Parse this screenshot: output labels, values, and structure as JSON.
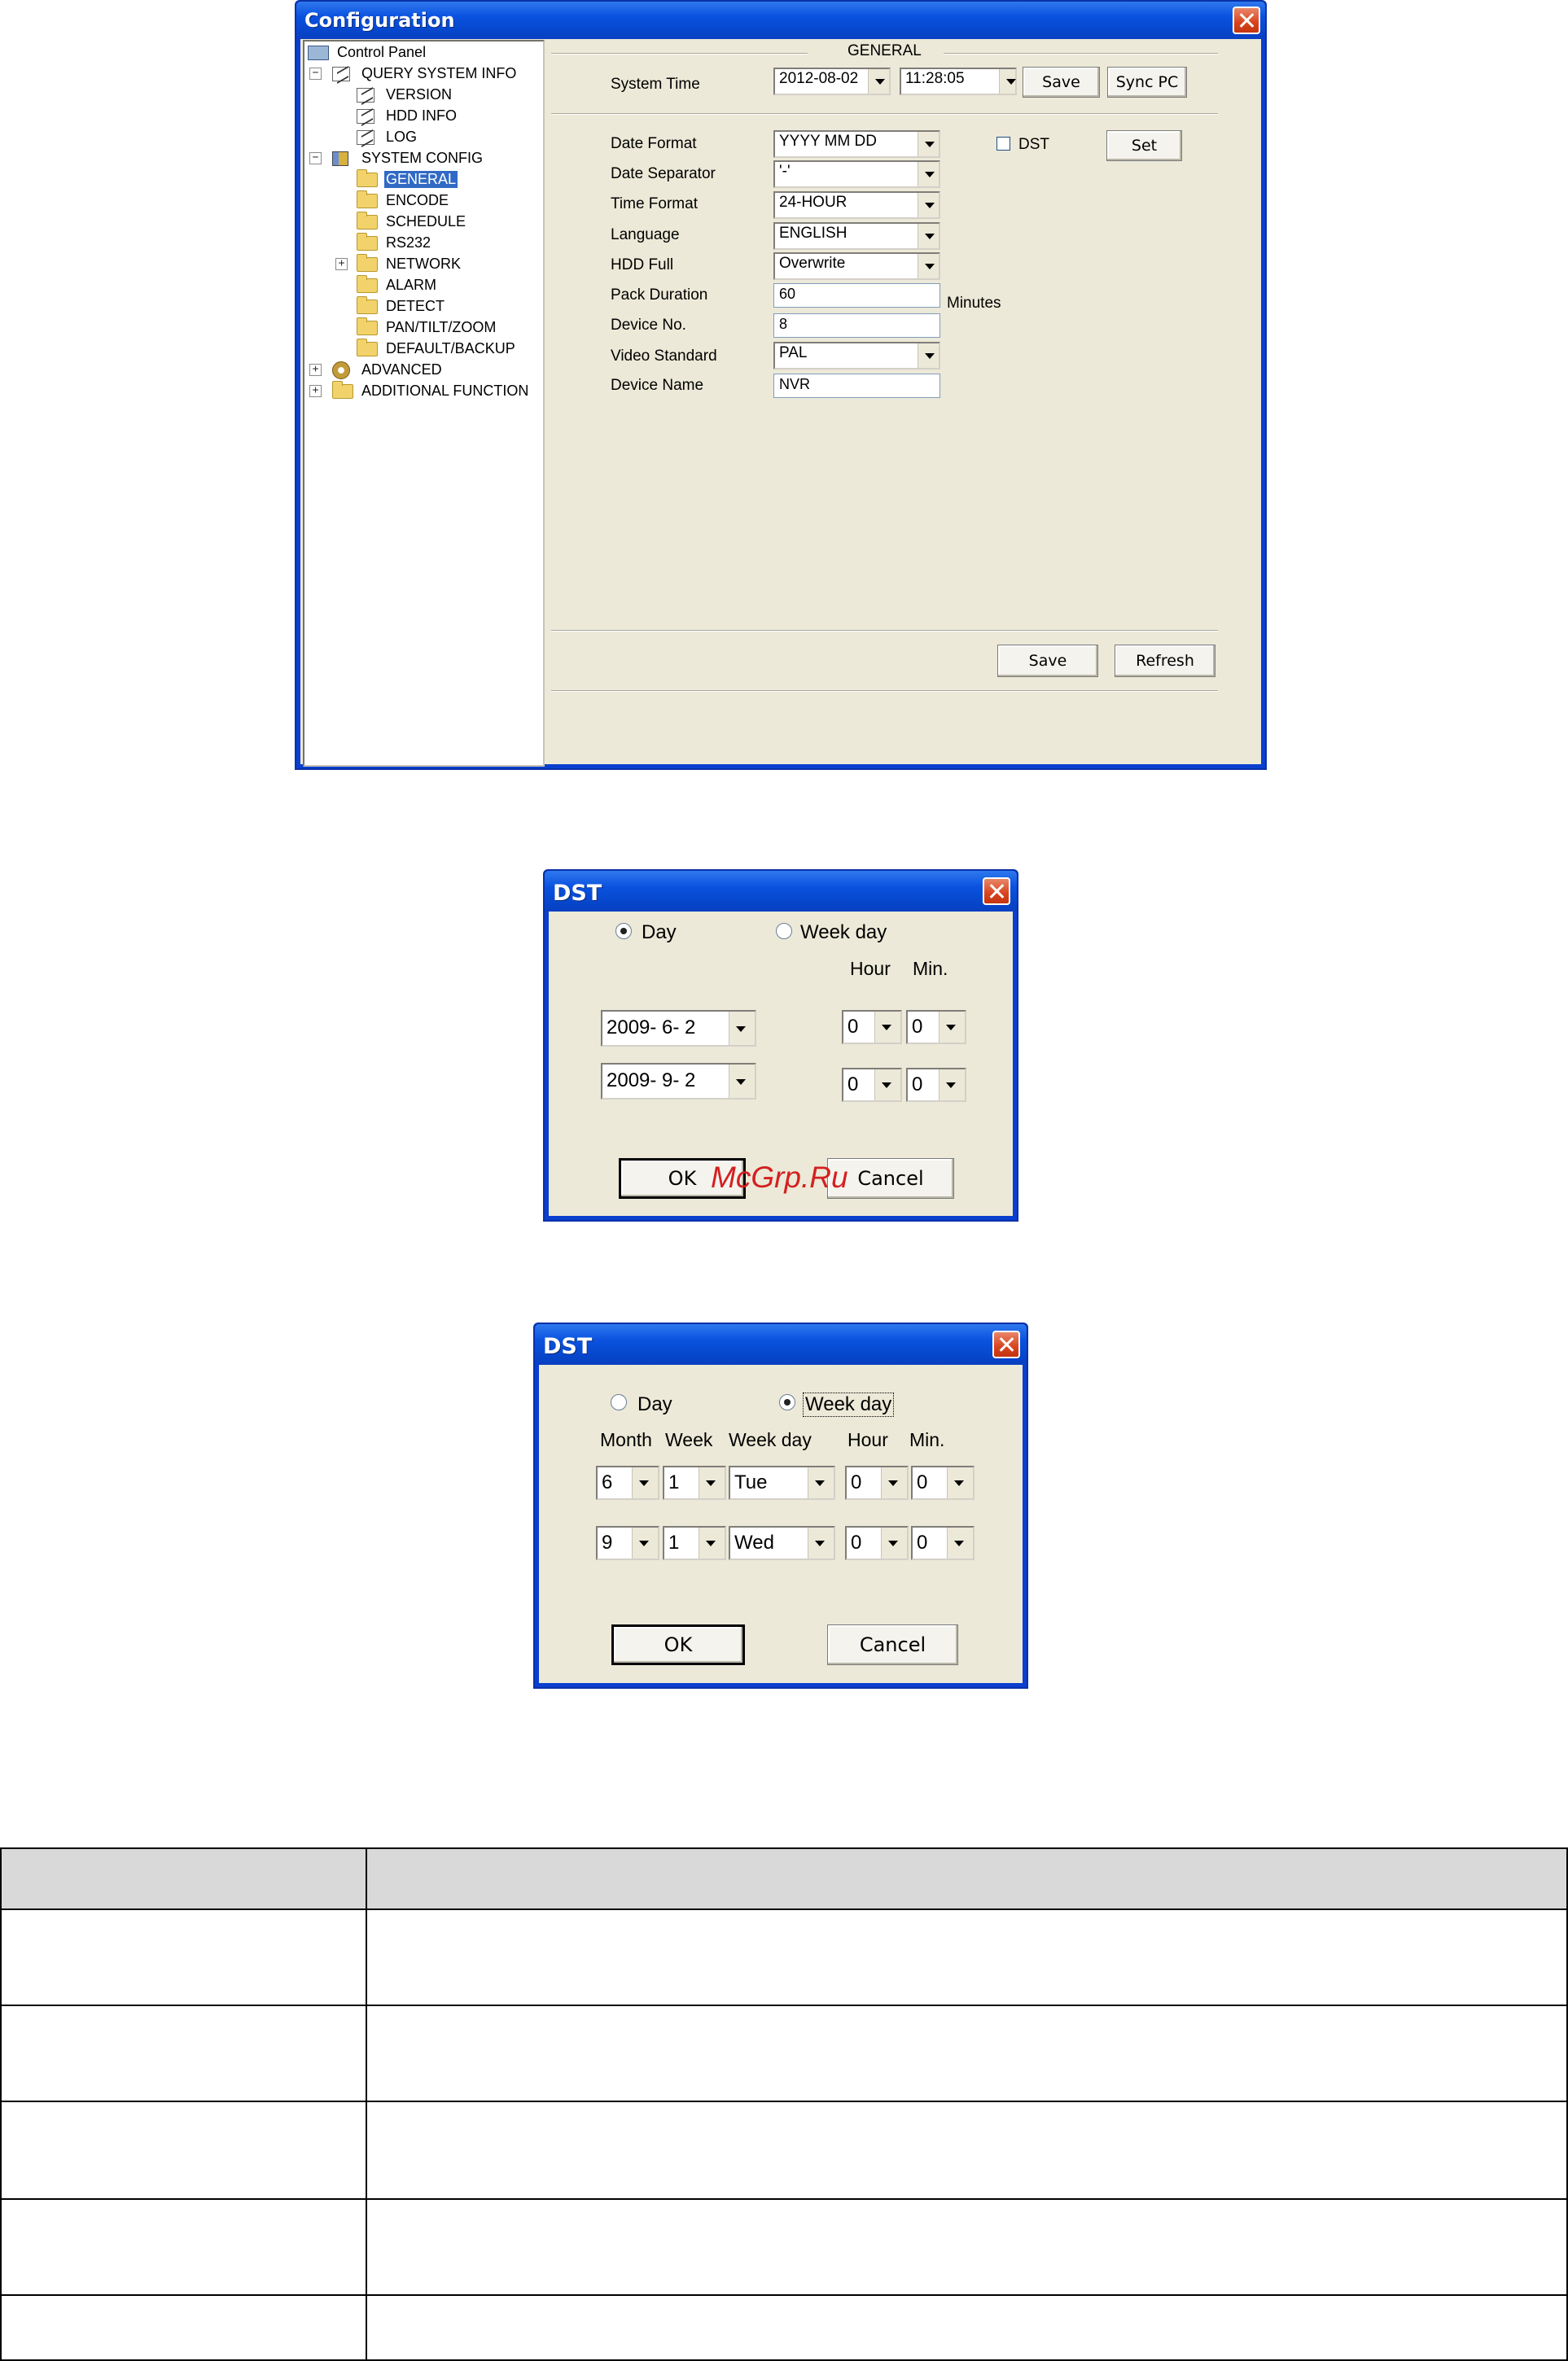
{
  "config": {
    "title": "Configuration",
    "section_title": "GENERAL",
    "tree": [
      {
        "label": "Control Panel",
        "icon": "computer-icon"
      },
      {
        "label": "QUERY SYSTEM INFO",
        "icon": "document-icon"
      },
      {
        "label": "VERSION",
        "icon": "document-icon"
      },
      {
        "label": "HDD INFO",
        "icon": "document-icon"
      },
      {
        "label": "LOG",
        "icon": "document-icon"
      },
      {
        "label": "SYSTEM CONFIG",
        "icon": "tools-icon"
      },
      {
        "label": "GENERAL",
        "icon": "folder-icon",
        "selected": true
      },
      {
        "label": "ENCODE",
        "icon": "folder-icon"
      },
      {
        "label": "SCHEDULE",
        "icon": "folder-icon"
      },
      {
        "label": "RS232",
        "icon": "folder-icon"
      },
      {
        "label": "NETWORK",
        "icon": "folder-icon"
      },
      {
        "label": "ALARM",
        "icon": "folder-icon"
      },
      {
        "label": "DETECT",
        "icon": "folder-icon"
      },
      {
        "label": "PAN/TILT/ZOOM",
        "icon": "folder-icon"
      },
      {
        "label": "DEFAULT/BACKUP",
        "icon": "folder-icon"
      },
      {
        "label": "ADVANCED",
        "icon": "gears-icon"
      },
      {
        "label": "ADDITIONAL FUNCTION",
        "icon": "folder-icon"
      }
    ],
    "system_time": {
      "label": "System Time",
      "date": "2012-08-02",
      "time": "11:28:05",
      "save_label": "Save",
      "sync_label": "Sync PC"
    },
    "fields": {
      "date_format": {
        "label": "Date Format",
        "value": "YYYY MM DD"
      },
      "date_separator": {
        "label": "Date Separator",
        "value": "'-'"
      },
      "time_format": {
        "label": "Time Format",
        "value": "24-HOUR"
      },
      "language": {
        "label": "Language",
        "value": "ENGLISH"
      },
      "hdd_full": {
        "label": "HDD Full",
        "value": "Overwrite"
      },
      "pack_duration": {
        "label": "Pack Duration",
        "value": "60",
        "unit": "Minutes"
      },
      "device_no": {
        "label": "Device No.",
        "value": "8"
      },
      "video_standard": {
        "label": "Video Standard",
        "value": "PAL"
      },
      "device_name": {
        "label": "Device Name",
        "value": "NVR"
      }
    },
    "dst": {
      "label": "DST",
      "checked": false,
      "set_label": "Set"
    },
    "buttons": {
      "save": "Save",
      "refresh": "Refresh"
    }
  },
  "dst_day": {
    "title": "DST",
    "mode_day": "Day",
    "mode_weekday": "Week day",
    "selected_mode": "Day",
    "hour_label": "Hour",
    "min_label": "Min.",
    "start": {
      "date": "2009- 6- 2",
      "hour": "0",
      "min": "0"
    },
    "end": {
      "date": "2009- 9- 2",
      "hour": "0",
      "min": "0"
    },
    "ok": "OK",
    "cancel": "Cancel"
  },
  "watermark": "McGrp.Ru",
  "dst_week": {
    "title": "DST",
    "mode_day": "Day",
    "mode_weekday": "Week day",
    "selected_mode": "Week day",
    "headers": {
      "month": "Month",
      "week": "Week",
      "weekday": "Week day",
      "hour": "Hour",
      "min": "Min."
    },
    "start": {
      "month": "6",
      "week": "1",
      "weekday": "Tue",
      "hour": "0",
      "min": "0"
    },
    "end": {
      "month": "9",
      "week": "1",
      "weekday": "Wed",
      "hour": "0",
      "min": "0"
    },
    "ok": "OK",
    "cancel": "Cancel"
  }
}
